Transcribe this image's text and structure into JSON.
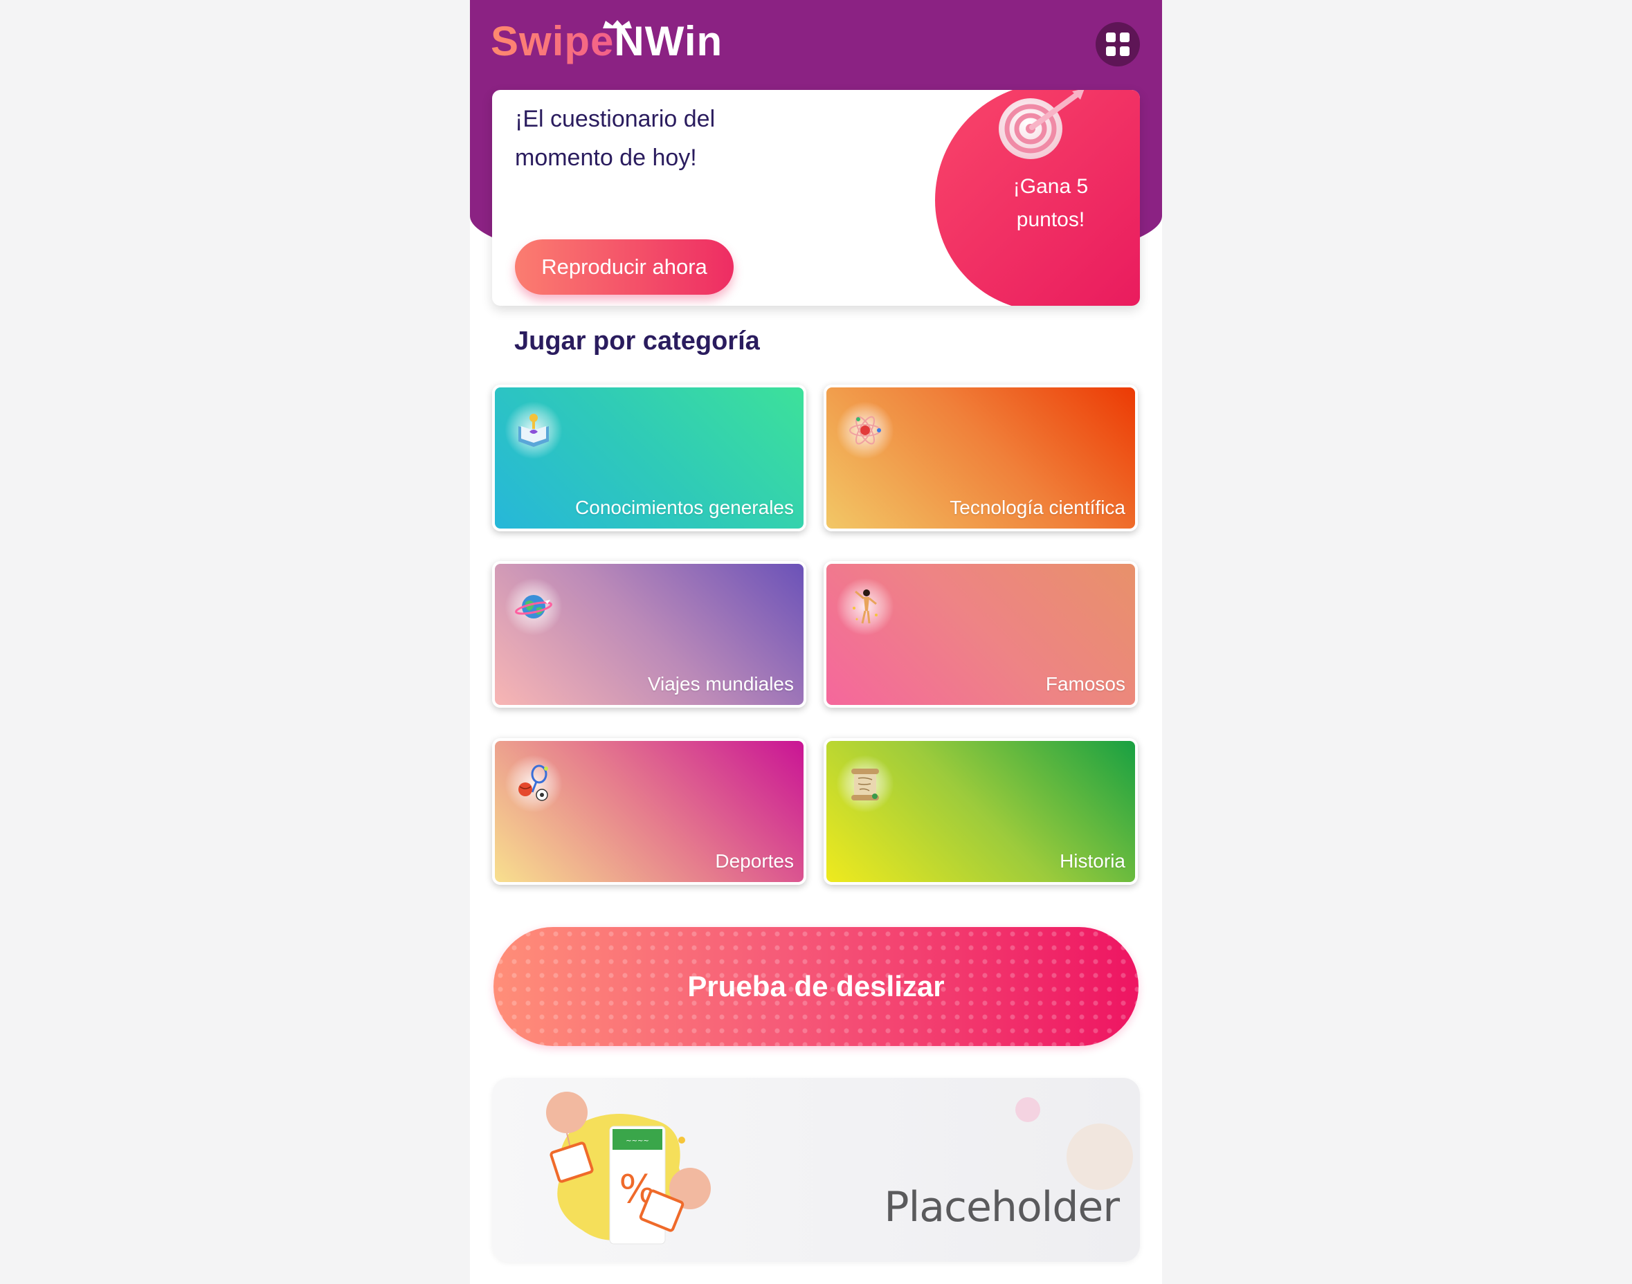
{
  "header": {
    "logo_part1": "Swipe",
    "logo_part2": "NWin",
    "menu_icon": "grid-icon",
    "bg_color": "#8b2283"
  },
  "quiz": {
    "title": "¡El cuestionario del momento de hoy!",
    "play_label": "Reproducir ahora",
    "prize_text": "¡Gana 5 puntos!",
    "prize_icon": "target-icon",
    "accent_color": "#ee2d63"
  },
  "categories": {
    "title": "Jugar por categoría",
    "items": [
      {
        "label": "Conocimientos generales",
        "icon": "book-icon"
      },
      {
        "label": "Tecnología científica",
        "icon": "atom-icon"
      },
      {
        "label": "Viajes mundiales",
        "icon": "globe-icon"
      },
      {
        "label": "Famosos",
        "icon": "star-person-icon"
      },
      {
        "label": "Deportes",
        "icon": "sports-icon"
      },
      {
        "label": "Historia",
        "icon": "scroll-icon"
      }
    ]
  },
  "swipe": {
    "label": "Prueba de deslizar"
  },
  "banner": {
    "text": "Placeholder",
    "icon": "gift-discount-icon"
  }
}
